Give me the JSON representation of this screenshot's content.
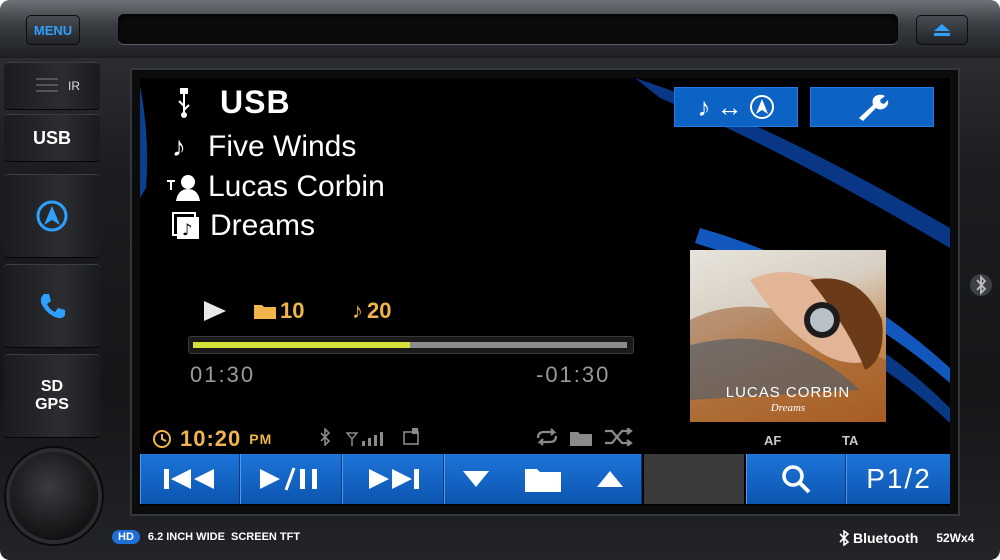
{
  "device": {
    "menu_label": "MENU",
    "ir_label": "IR",
    "side_buttons": [
      {
        "label": "USB"
      },
      {
        "icon": "navigation-icon"
      },
      {
        "icon": "phone-icon"
      },
      {
        "label_line1": "SD",
        "label_line2": "GPS"
      }
    ],
    "footer": {
      "hd_badge": "HD",
      "screen_text": "6.2 INCH WIDE  SCREEN TFT",
      "bluetooth_text": "Bluetooth",
      "power_text": "52Wx4"
    }
  },
  "player": {
    "source": "USB",
    "track_title": "Five Winds",
    "artist": "Lucas Corbin",
    "album": "Dreams",
    "folder_number": "10",
    "track_number": "20",
    "elapsed": "01:30",
    "remaining": "-01:30",
    "progress_fraction": 0.5,
    "album_art": {
      "artist_text": "LUCAS CORBIN",
      "album_text": "Dreams"
    }
  },
  "status_bar": {
    "time": "10:20",
    "ampm": "PM",
    "af_label": "AF",
    "ta_label": "TA"
  },
  "toolbar": {
    "page_label": "P1/2"
  },
  "colors": {
    "accent_blue": "#0d63c3",
    "clock_amber": "#f0b44a",
    "progress_fill": "#d4e23a",
    "nav_cyan": "#2ea0ff"
  }
}
